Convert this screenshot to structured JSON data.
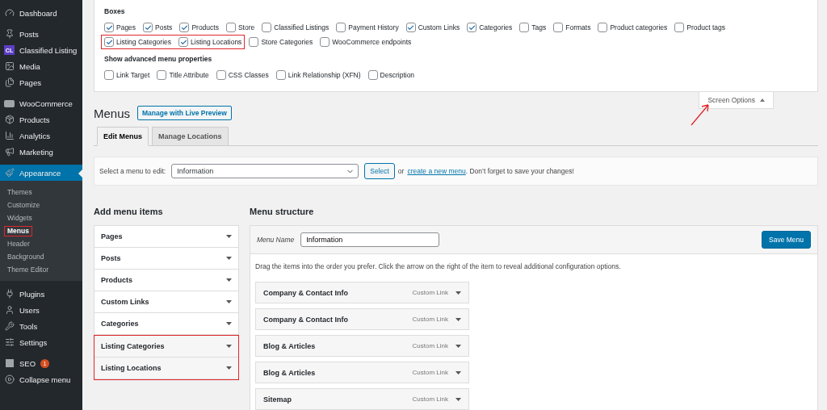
{
  "sidebar": {
    "groups": [
      {
        "items": [
          {
            "label": "Dashboard",
            "selected": false
          }
        ]
      },
      {
        "items": [
          {
            "label": "Posts",
            "selected": false
          },
          {
            "label": "Classified Listing",
            "icon_text": "CL",
            "selected": false
          },
          {
            "label": "Media",
            "selected": false
          },
          {
            "label": "Pages",
            "selected": false
          }
        ]
      },
      {
        "items": [
          {
            "label": "WooCommerce",
            "selected": false
          },
          {
            "label": "Products",
            "selected": false
          },
          {
            "label": "Analytics",
            "selected": false
          },
          {
            "label": "Marketing",
            "selected": false
          }
        ]
      },
      {
        "items": [
          {
            "label": "Appearance",
            "selected": true,
            "children": [
              {
                "label": "Themes",
                "selected": false,
                "highlighted": false
              },
              {
                "label": "Customize",
                "selected": false,
                "highlighted": false
              },
              {
                "label": "Widgets",
                "selected": false,
                "highlighted": false
              },
              {
                "label": "Menus",
                "selected": true,
                "highlighted": true
              },
              {
                "label": "Header",
                "selected": false,
                "highlighted": false
              },
              {
                "label": "Background",
                "selected": false,
                "highlighted": false
              },
              {
                "label": "Theme Editor",
                "selected": false,
                "highlighted": false
              }
            ]
          }
        ]
      },
      {
        "items": [
          {
            "label": "Plugins",
            "selected": false
          },
          {
            "label": "Users",
            "selected": false
          },
          {
            "label": "Tools",
            "selected": false
          },
          {
            "label": "Settings",
            "selected": false
          }
        ]
      },
      {
        "items": [
          {
            "label": "SEO",
            "badge": "1",
            "selected": false
          },
          {
            "label": "Collapse menu",
            "selected": false
          }
        ]
      }
    ]
  },
  "screen_options": {
    "boxes_label": "Boxes",
    "box_rows": [
      {
        "items": [
          {
            "label": "Pages",
            "checked": true,
            "highlighted": false
          },
          {
            "label": "Posts",
            "checked": true,
            "highlighted": false
          },
          {
            "label": "Products",
            "checked": true,
            "highlighted": false
          },
          {
            "label": "Store",
            "checked": false,
            "highlighted": false
          },
          {
            "label": "Classified Listings",
            "checked": false,
            "highlighted": false
          },
          {
            "label": "Payment History",
            "checked": false,
            "highlighted": false
          },
          {
            "label": "Custom Links",
            "checked": true,
            "highlighted": false
          },
          {
            "label": "Categories",
            "checked": true,
            "highlighted": false
          },
          {
            "label": "Tags",
            "checked": false,
            "highlighted": false
          },
          {
            "label": "Formats",
            "checked": false,
            "highlighted": false
          },
          {
            "label": "Product categories",
            "checked": false,
            "highlighted": false
          },
          {
            "label": "Product tags",
            "checked": false,
            "highlighted": false
          }
        ]
      },
      {
        "items": [
          {
            "label": "Listing Categories",
            "checked": true,
            "highlighted": true
          },
          {
            "label": "Listing Locations",
            "checked": true,
            "highlighted": true
          },
          {
            "label": "Store Categories",
            "checked": false,
            "highlighted": false
          },
          {
            "label": "WooCommerce endpoints",
            "checked": false,
            "highlighted": false
          }
        ]
      }
    ],
    "advanced_label": "Show advanced menu properties",
    "advanced": [
      {
        "label": "Link Target",
        "checked": false,
        "highlighted": false
      },
      {
        "label": "Title Attribute",
        "checked": false,
        "highlighted": false
      },
      {
        "label": "CSS Classes",
        "checked": false,
        "highlighted": false
      },
      {
        "label": "Link Relationship (XFN)",
        "checked": false,
        "highlighted": false
      },
      {
        "label": "Description",
        "checked": false,
        "highlighted": false
      }
    ],
    "toggle": {
      "label": "Screen Options",
      "expanded": true,
      "pointed_at": true
    }
  },
  "page": {
    "title": "Menus",
    "live_preview_button": "Manage with Live Preview"
  },
  "tabs": [
    {
      "label": "Edit Menus",
      "selected": true
    },
    {
      "label": "Manage Locations",
      "selected": false
    }
  ],
  "select_bar": {
    "label": "Select a menu to edit:",
    "value": "Information",
    "button": "Select",
    "text_before": "or",
    "link": "create a new menu",
    "text_after": ". Don’t forget to save your changes!"
  },
  "add_menu_items": {
    "title": "Add menu items",
    "sections": [
      {
        "label": "Pages",
        "highlighted": false
      },
      {
        "label": "Posts",
        "highlighted": false
      },
      {
        "label": "Products",
        "highlighted": false
      },
      {
        "label": "Custom Links",
        "highlighted": false
      },
      {
        "label": "Categories",
        "highlighted": false
      },
      {
        "label": "Listing Categories",
        "highlighted": true
      },
      {
        "label": "Listing Locations",
        "highlighted": true
      }
    ]
  },
  "menu_structure": {
    "title": "Menu structure",
    "name_label": "Menu Name",
    "name_value": "Information",
    "save_button": "Save Menu",
    "instructions": "Drag the items into the order you prefer. Click the arrow on the right of the item to reveal additional configuration options.",
    "items": [
      {
        "title": "Company & Contact Info",
        "type": "Custom Link"
      },
      {
        "title": "Company & Contact Info",
        "type": "Custom Link"
      },
      {
        "title": "Blog & Articles",
        "type": "Custom Link"
      },
      {
        "title": "Blog & Articles",
        "type": "Custom Link"
      },
      {
        "title": "Sitemap",
        "type": "Custom Link"
      }
    ]
  }
}
